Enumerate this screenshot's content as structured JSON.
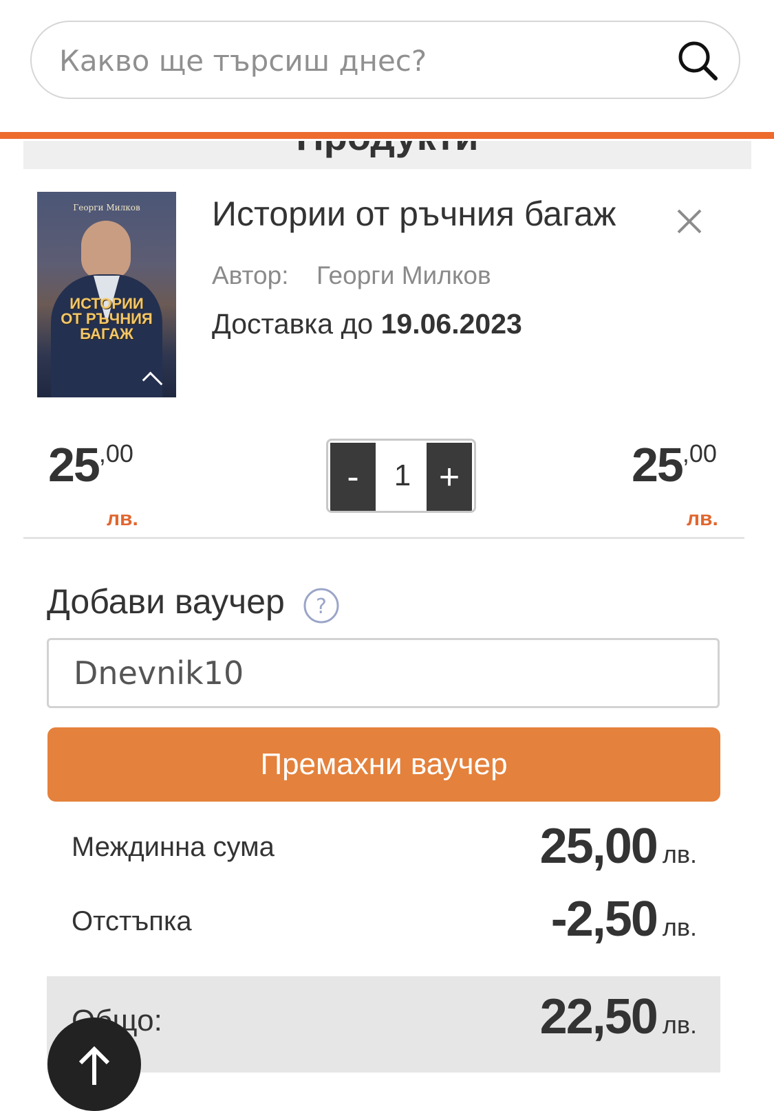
{
  "search": {
    "placeholder": "Какво ще търсиш днес?"
  },
  "section": {
    "title": "Продукти"
  },
  "product": {
    "cover": {
      "author": "Георги Милков",
      "title_line1": "ИСТОРИИ",
      "title_line2": "ОТ РЪЧНИЯ",
      "title_line3": "БАГАЖ"
    },
    "title": "Истории от ръчния багаж",
    "author_label": "Автор:",
    "author_name": "Георги Милков",
    "delivery_label": "Доставка до",
    "delivery_date": "19.06.2023",
    "unit_price_whole": "25",
    "unit_price_fraction": ",00",
    "unit_currency": "лв.",
    "quantity": "1",
    "qty_minus": "-",
    "qty_plus": "+",
    "line_total_whole": "25",
    "line_total_fraction": ",00",
    "line_currency": "лв."
  },
  "voucher": {
    "title": "Добави ваучер",
    "help": "?",
    "code": "Dnevnik10",
    "remove_label": "Премахни ваучер"
  },
  "summary": {
    "subtotal_label": "Междинна сума",
    "subtotal_value": "25,00",
    "discount_label": "Отстъпка",
    "discount_value": "-2,50",
    "total_label": "Общо:",
    "total_value": "22,50",
    "currency": "лв."
  },
  "colors": {
    "accent": "#ec6b2d",
    "button": "#e4813c",
    "dark": "#3a3a3a"
  }
}
